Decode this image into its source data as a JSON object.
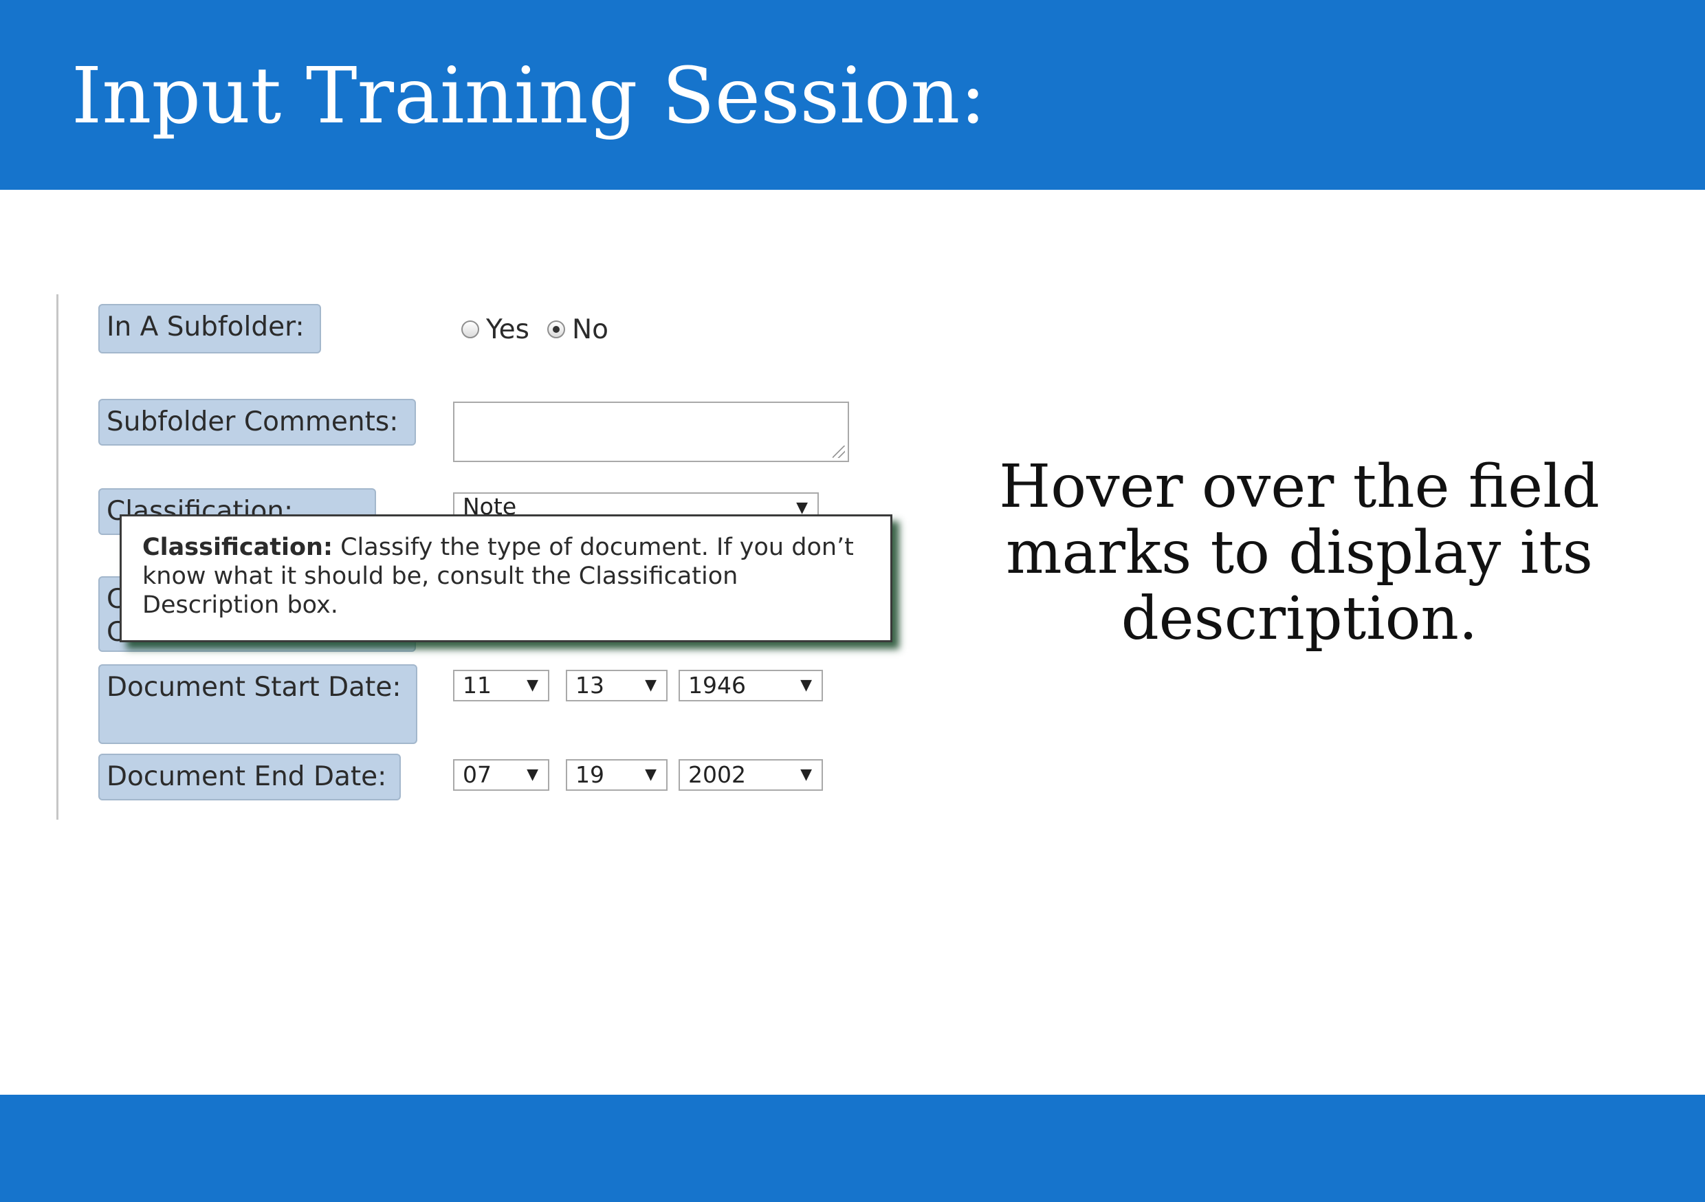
{
  "slide": {
    "title": "Input Training Session:",
    "hint": "Hover over the field marks to display its description.",
    "banner_color": "#1674cc"
  },
  "form": {
    "in_subfolder": {
      "label": "In A Subfolder:",
      "options": [
        "Yes",
        "No"
      ],
      "selected": "No"
    },
    "subfolder_comments": {
      "label": "Subfolder Comments:",
      "value": ""
    },
    "classification": {
      "label": "Classification:",
      "value": "Note"
    },
    "hidden_label": {
      "line1": "C",
      "line2": "C"
    },
    "document_start_date": {
      "label": "Document Start Date:",
      "month": "11",
      "day": "13",
      "year": "1946"
    },
    "document_end_date": {
      "label": "Document End Date:",
      "month": "07",
      "day": "19",
      "year": "2002"
    }
  },
  "tooltip": {
    "term": "Classification:",
    "text": "Classify the type of document. If you don’t know what it should be, consult the Classification Description box."
  },
  "icons": {
    "dropdown": "chevron-down-icon",
    "resize": "resize-grip-icon"
  }
}
